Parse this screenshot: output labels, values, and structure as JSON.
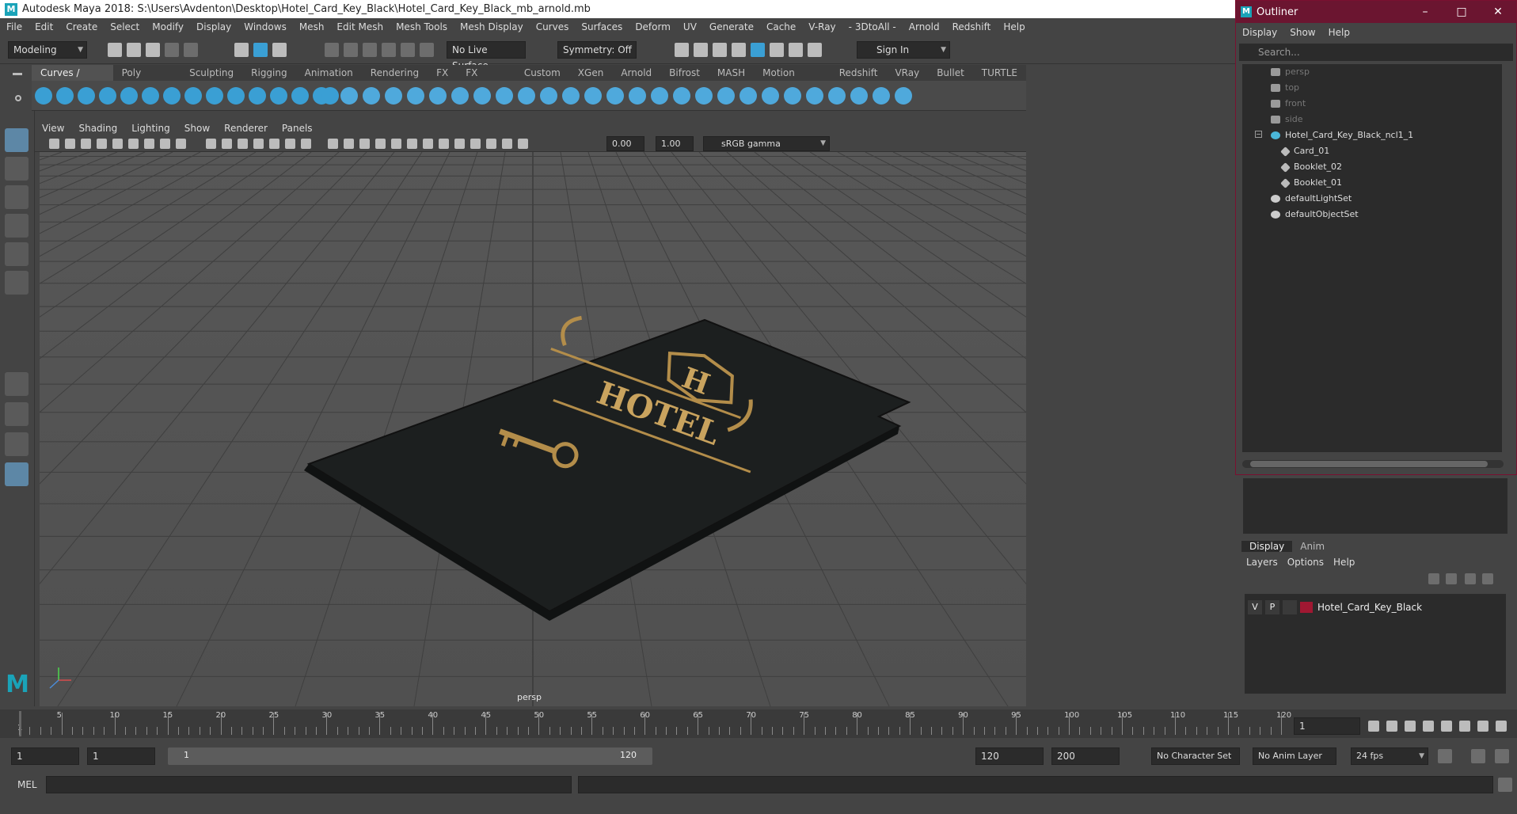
{
  "window": {
    "title": "Autodesk Maya 2018: S:\\Users\\Avdenton\\Desktop\\Hotel_Card_Key_Black\\Hotel_Card_Key_Black_mb_arnold.mb"
  },
  "menu": [
    "File",
    "Edit",
    "Create",
    "Select",
    "Modify",
    "Display",
    "Windows",
    "Mesh",
    "Edit Mesh",
    "Mesh Tools",
    "Mesh Display",
    "Curves",
    "Surfaces",
    "Deform",
    "UV",
    "Generate",
    "Cache",
    "V-Ray",
    "- 3DtoAll -",
    "Arnold",
    "Redshift",
    "Help"
  ],
  "status": {
    "mode": "Modeling",
    "live_surface": "No Live Surface",
    "symmetry": "Symmetry: Off",
    "sign_in": "Sign In"
  },
  "shelf_tabs": [
    "Curves / Surfaces",
    "Poly Modeling",
    "Sculpting",
    "Rigging",
    "Animation",
    "Rendering",
    "FX",
    "FX Caching",
    "Custom",
    "XGen",
    "Arnold",
    "Bifrost",
    "MASH",
    "Motion Graphics",
    "Redshift",
    "VRay",
    "Bullet",
    "TURTLE"
  ],
  "panel_menu": [
    "View",
    "Shading",
    "Lighting",
    "Show",
    "Renderer",
    "Panels"
  ],
  "panel_toolbar": {
    "exposure": "0.00",
    "gamma": "1.00",
    "color_space": "sRGB gamma"
  },
  "viewport": {
    "camera_label": "persp",
    "card_text": "HOTEL",
    "card_letter": "H"
  },
  "timeline": {
    "ticks": [
      "5",
      "10",
      "15",
      "20",
      "25",
      "30",
      "35",
      "40",
      "45",
      "50",
      "55",
      "60",
      "65",
      "70",
      "75",
      "80",
      "85",
      "90",
      "95",
      "100",
      "105",
      "110",
      "115",
      "120"
    ],
    "first_tick": "1",
    "current_frame": "1"
  },
  "range": {
    "start": "1",
    "playback_start": "1",
    "slider_start": "1",
    "slider_end": "120",
    "playback_end": "120",
    "end": "200",
    "character_set": "No Character Set",
    "anim_layer": "No Anim Layer",
    "fps": "24 fps"
  },
  "cmd": {
    "label": "MEL"
  },
  "outliner": {
    "title": "Outliner",
    "menu": [
      "Display",
      "Show",
      "Help"
    ],
    "search_placeholder": "Search...",
    "items": [
      {
        "label": "persp",
        "type": "camera",
        "indent": 0,
        "dim": true
      },
      {
        "label": "top",
        "type": "camera",
        "indent": 0,
        "dim": true
      },
      {
        "label": "front",
        "type": "camera",
        "indent": 0,
        "dim": true
      },
      {
        "label": "side",
        "type": "camera",
        "indent": 0,
        "dim": true
      },
      {
        "label": "Hotel_Card_Key_Black_ncl1_1",
        "type": "group",
        "indent": 0,
        "dim": false
      },
      {
        "label": "Card_01",
        "type": "mesh",
        "indent": 1,
        "dim": false
      },
      {
        "label": "Booklet_02",
        "type": "mesh",
        "indent": 1,
        "dim": false
      },
      {
        "label": "Booklet_01",
        "type": "mesh",
        "indent": 1,
        "dim": false
      },
      {
        "label": "defaultLightSet",
        "type": "set",
        "indent": 0,
        "dim": false
      },
      {
        "label": "defaultObjectSet",
        "type": "set",
        "indent": 0,
        "dim": false
      }
    ]
  },
  "layers": {
    "tabs": [
      "Display",
      "Anim"
    ],
    "menu": [
      "Layers",
      "Options",
      "Help"
    ],
    "row": {
      "v": "V",
      "p": "P",
      "name": "Hotel_Card_Key_Black",
      "color": "#a01832"
    }
  }
}
